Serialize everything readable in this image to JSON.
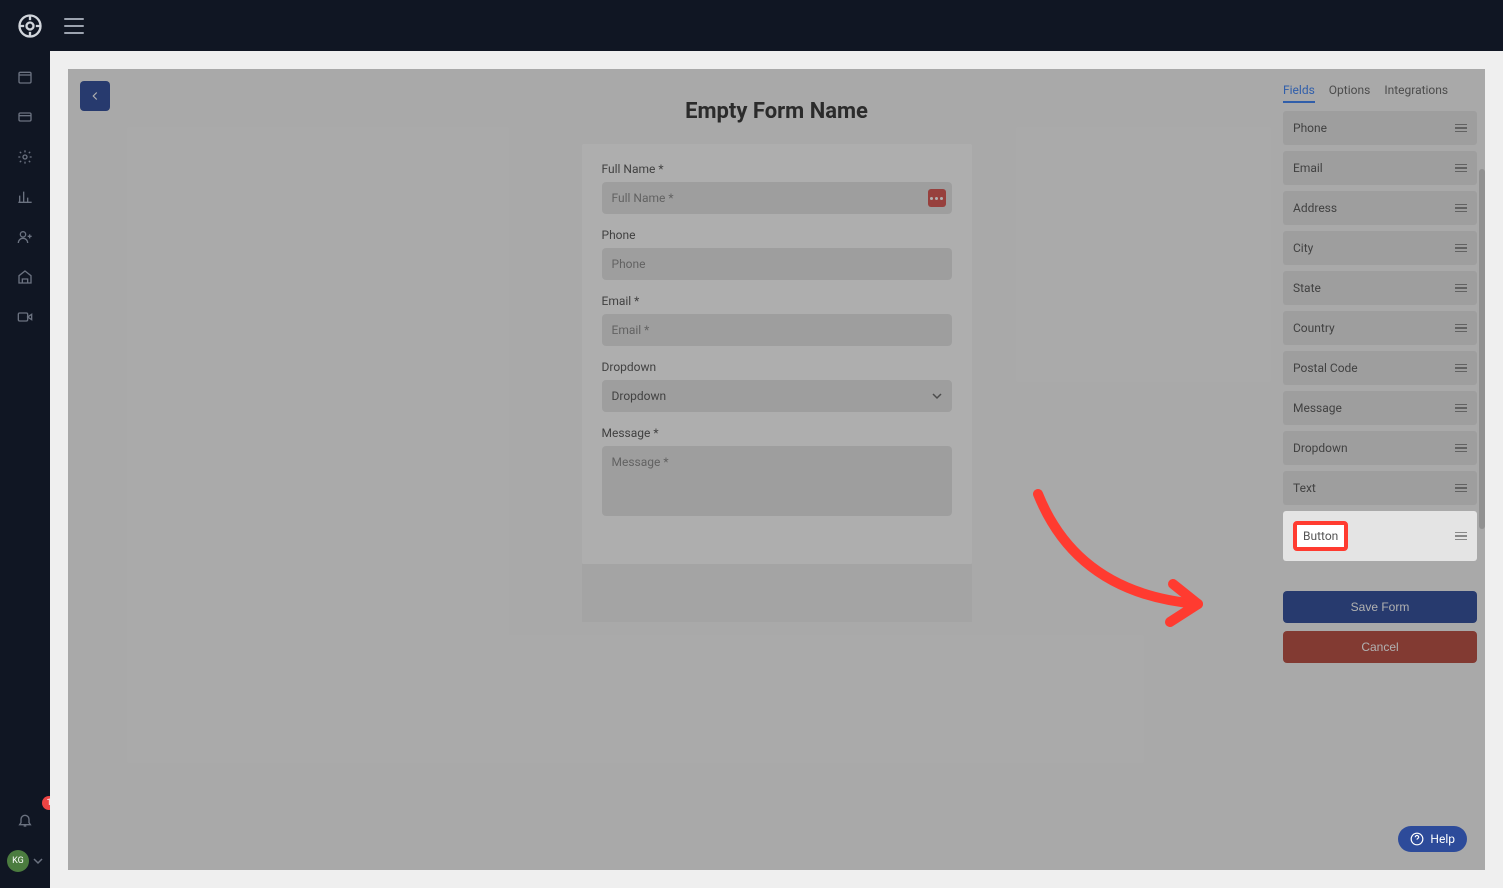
{
  "header": {
    "notifications_count": "1",
    "avatar_initials": "KG"
  },
  "page": {
    "title": "Empty Form Name"
  },
  "form": {
    "fields": [
      {
        "label": "Full Name *",
        "placeholder": "Full Name *",
        "type": "text",
        "hasDots": true
      },
      {
        "label": "Phone",
        "placeholder": "Phone",
        "type": "text"
      },
      {
        "label": "Email *",
        "placeholder": "Email *",
        "type": "text"
      },
      {
        "label": "Dropdown",
        "placeholder": "Dropdown",
        "type": "select"
      },
      {
        "label": "Message *",
        "placeholder": "Message *",
        "type": "textarea"
      }
    ]
  },
  "rightPanel": {
    "tabs": [
      "Fields",
      "Options",
      "Integrations"
    ],
    "activeTab": 0,
    "fieldTypes": [
      "Phone",
      "Email",
      "Address",
      "City",
      "State",
      "Country",
      "Postal Code",
      "Message",
      "Dropdown",
      "Text",
      "Button"
    ],
    "highlightedIndex": 10,
    "saveLabel": "Save Form",
    "cancelLabel": "Cancel"
  },
  "help": {
    "label": "Help"
  }
}
